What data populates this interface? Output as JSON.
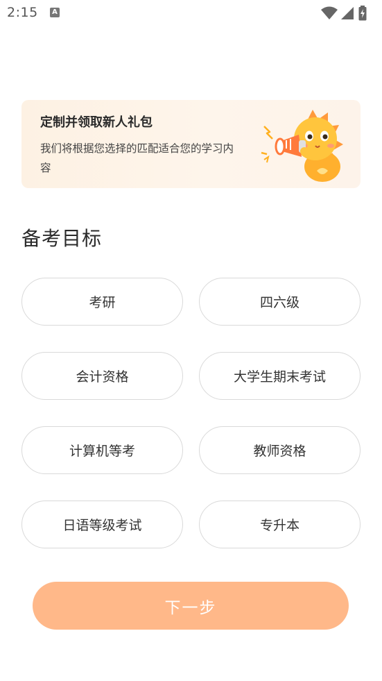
{
  "status_bar": {
    "time": "2:15",
    "app_icon_letter": "A",
    "icons": [
      "wifi-icon",
      "signal-icon",
      "battery-charging-icon"
    ]
  },
  "banner": {
    "title": "定制并领取新人礼包",
    "description": "我们将根据您选择的匹配适合您的学习内容",
    "illustration": "mascot-megaphone"
  },
  "section": {
    "title": "备考目标"
  },
  "options": [
    {
      "label": "考研"
    },
    {
      "label": "四六级"
    },
    {
      "label": "会计资格"
    },
    {
      "label": "大学生期末考试"
    },
    {
      "label": "计算机等考"
    },
    {
      "label": "教师资格"
    },
    {
      "label": "日语等级考试"
    },
    {
      "label": "专升本"
    }
  ],
  "next_button": {
    "label": "下一步"
  },
  "colors": {
    "accent": "#ffb889",
    "banner_bg": "#fdf1e3",
    "option_border": "#d9d9d9",
    "mascot_yellow": "#ffc53d",
    "mascot_orange": "#ff9a3c"
  }
}
